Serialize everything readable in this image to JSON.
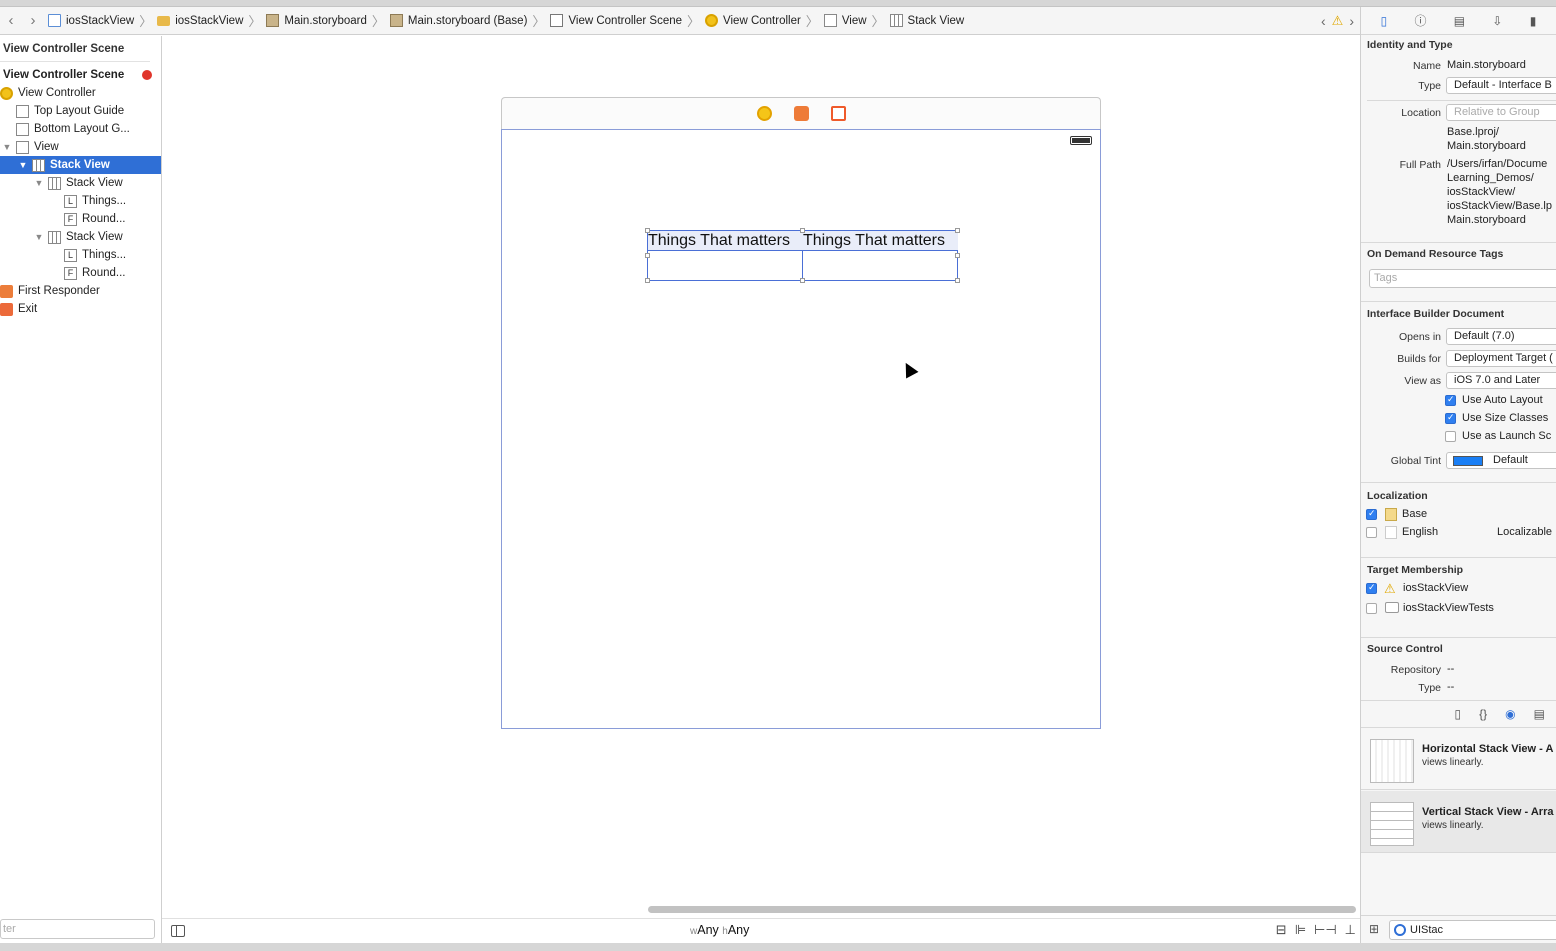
{
  "breadcrumbs": [
    {
      "label": "iosStackView",
      "icon": "file-icon"
    },
    {
      "label": "iosStackView",
      "icon": "folder-icon"
    },
    {
      "label": "Main.storyboard",
      "icon": "storyboard-icon"
    },
    {
      "label": "Main.storyboard (Base)",
      "icon": "storyboard-icon"
    },
    {
      "label": "View Controller Scene",
      "icon": "scene-icon"
    },
    {
      "label": "View Controller",
      "icon": "view-controller-icon"
    },
    {
      "label": "View",
      "icon": "view-icon"
    },
    {
      "label": "Stack View",
      "icon": "stack-view-icon"
    }
  ],
  "outline": {
    "header": "View Controller Scene",
    "items": [
      {
        "label": "View Controller Scene"
      },
      {
        "label": "View Controller"
      },
      {
        "label": "Top Layout Guide"
      },
      {
        "label": "Bottom Layout G..."
      },
      {
        "label": "View"
      },
      {
        "label": "Stack View"
      },
      {
        "label": "Stack View"
      },
      {
        "label": "Things...",
        "badge": "L"
      },
      {
        "label": "Round...",
        "badge": "F"
      },
      {
        "label": "Stack View"
      },
      {
        "label": "Things...",
        "badge": "L"
      },
      {
        "label": "Round...",
        "badge": "F"
      },
      {
        "label": "First Responder"
      },
      {
        "label": "Exit"
      }
    ],
    "filter_placeholder": "ter"
  },
  "canvas": {
    "label_1": "Things That matters",
    "label_2": "Things That matters",
    "size_class": {
      "w_prefix": "w",
      "w_value": "Any",
      "h_prefix": "h",
      "h_value": "Any"
    }
  },
  "inspector": {
    "identity": {
      "title": "Identity and Type",
      "name_label": "Name",
      "name_value": "Main.storyboard",
      "type_label": "Type",
      "type_value": "Default - Interface B",
      "location_label": "Location",
      "location_value": "Relative to Group",
      "location_path_1": "Base.lproj/",
      "location_path_2": "Main.storyboard",
      "fullpath_label": "Full Path",
      "fullpath_1": "/Users/irfan/Docume",
      "fullpath_2": "Learning_Demos/",
      "fullpath_3": "iosStackView/",
      "fullpath_4": "iosStackView/Base.lp",
      "fullpath_5": "Main.storyboard"
    },
    "tags": {
      "title": "On Demand Resource Tags",
      "placeholder": "Tags"
    },
    "ib_doc": {
      "title": "Interface Builder Document",
      "opens_label": "Opens in",
      "opens_value": "Default (7.0)",
      "builds_label": "Builds for",
      "builds_value": "Deployment Target (",
      "viewas_label": "View as",
      "viewas_value": "iOS 7.0 and Later",
      "auto_layout": "Use Auto Layout",
      "size_classes": "Use Size Classes",
      "launch_screen": "Use as Launch Sc",
      "tint_label": "Global Tint",
      "tint_value": "Default",
      "tint_color": "#1a7ff5"
    },
    "localization": {
      "title": "Localization",
      "base": "Base",
      "english": "English",
      "english_value": "Localizable"
    },
    "target": {
      "title": "Target Membership",
      "app": "iosStackView",
      "tests": "iosStackViewTests"
    },
    "source_control": {
      "title": "Source Control",
      "repo_label": "Repository",
      "repo_value": "--",
      "type_label": "Type",
      "type_value": "--"
    }
  },
  "library": {
    "items": [
      {
        "title": "Horizontal Stack View - A",
        "desc": "views linearly."
      },
      {
        "title": "Vertical Stack View - Arra",
        "desc": "views linearly."
      }
    ],
    "search_value": "UIStac"
  },
  "colors": {
    "selection": "#2f6fd6",
    "accent": "#2f7ff0",
    "scene_border": "#8a9cd8"
  }
}
